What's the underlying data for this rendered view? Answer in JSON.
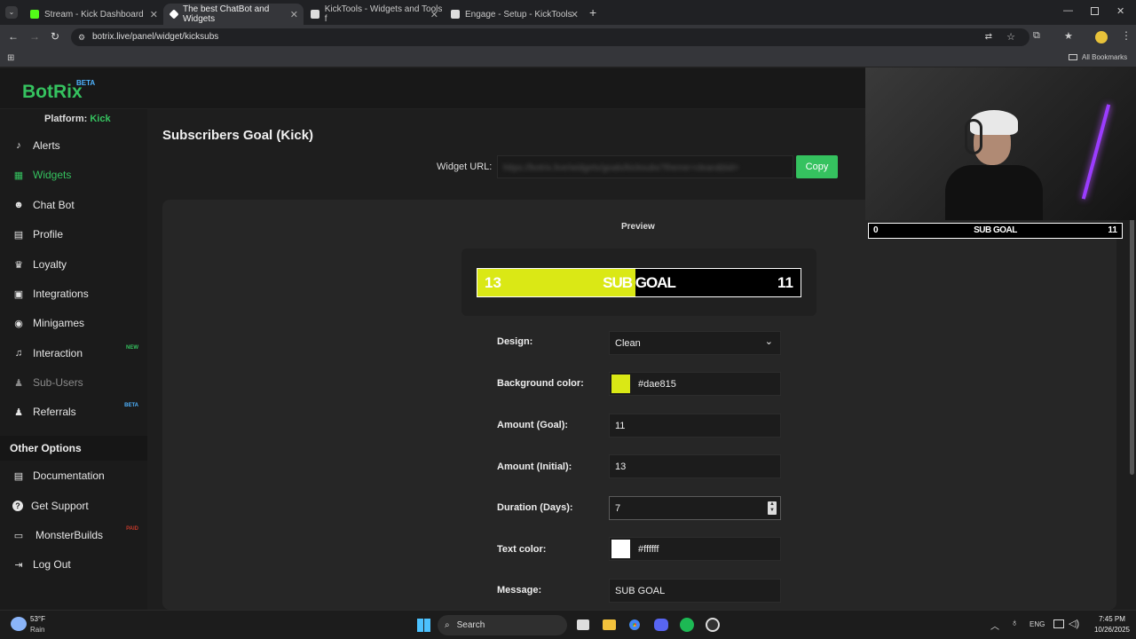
{
  "browser": {
    "tabs": [
      {
        "label": "Stream - Kick Dashboard",
        "fav_color": "#53fc18"
      },
      {
        "label": "The best ChatBot and Widgets",
        "fav_color": "#ffffff"
      },
      {
        "label": "KickTools - Widgets and Tools f",
        "fav_color": "#dddddd"
      },
      {
        "label": "Engage - Setup - KickTools",
        "fav_color": "#dddddd"
      }
    ],
    "url": "botrix.live/panel/widget/kicksubs",
    "all_bookmarks": "All Bookmarks"
  },
  "brand": {
    "name": "BotRix",
    "beta": "BETA",
    "color": "#35c25f"
  },
  "platform": {
    "label": "Platform:",
    "value": "Kick"
  },
  "sidebar": {
    "items": [
      {
        "label": "Alerts",
        "icon": "bell-icon"
      },
      {
        "label": "Widgets",
        "icon": "grid-icon",
        "active": true
      },
      {
        "label": "Chat Bot",
        "icon": "robot-icon"
      },
      {
        "label": "Profile",
        "icon": "id-card-icon"
      },
      {
        "label": "Loyalty",
        "icon": "trophy-icon"
      },
      {
        "label": "Integrations",
        "icon": "puzzle-icon"
      },
      {
        "label": "Minigames",
        "icon": "gamepad-icon"
      },
      {
        "label": "Interaction",
        "icon": "music-icon",
        "badge": "NEW"
      },
      {
        "label": "Sub-Users",
        "icon": "users-icon"
      },
      {
        "label": "Referrals",
        "icon": "user-group-icon",
        "badge": "BETA"
      }
    ],
    "other_title": "Other Options",
    "other_items": [
      {
        "label": "Documentation",
        "icon": "book-icon"
      },
      {
        "label": "Get Support",
        "icon": "question-icon"
      },
      {
        "label": "MonsterBuilds",
        "icon": "laptop-icon",
        "badge": "PAID"
      },
      {
        "label": "Log Out",
        "icon": "logout-icon"
      }
    ]
  },
  "page": {
    "title": "Subscribers Goal (Kick)",
    "widget_url_label": "Widget URL:",
    "widget_url_value": "https://botrix.live/widgets/goals/kicksubs?theme=clean&bid=",
    "copy_label": "Copy"
  },
  "preview": {
    "title": "Preview",
    "left": "13",
    "center": "SUB GOAL",
    "right": "11",
    "fill_fraction": 0.49,
    "fill_color": "#dae815"
  },
  "form": {
    "design": {
      "label": "Design:",
      "value": "Clean"
    },
    "bg_color": {
      "label": "Background color:",
      "value": "#dae815"
    },
    "goal": {
      "label": "Amount (Goal):",
      "value": "11"
    },
    "initial": {
      "label": "Amount (Initial):",
      "value": "13"
    },
    "duration": {
      "label": "Duration (Days):",
      "value": "7"
    },
    "text_color": {
      "label": "Text color:",
      "value": "#ffffff"
    },
    "message": {
      "label": "Message:",
      "value": "SUB GOAL"
    }
  },
  "overlay_bar": {
    "left": "0",
    "center": "SUB GOAL",
    "right": "11"
  },
  "taskbar": {
    "weather_temp": "53°F",
    "weather_desc": "Rain",
    "search": "Search",
    "lang": "ENG",
    "time": "7:45 PM",
    "date": "10/26/2025"
  }
}
